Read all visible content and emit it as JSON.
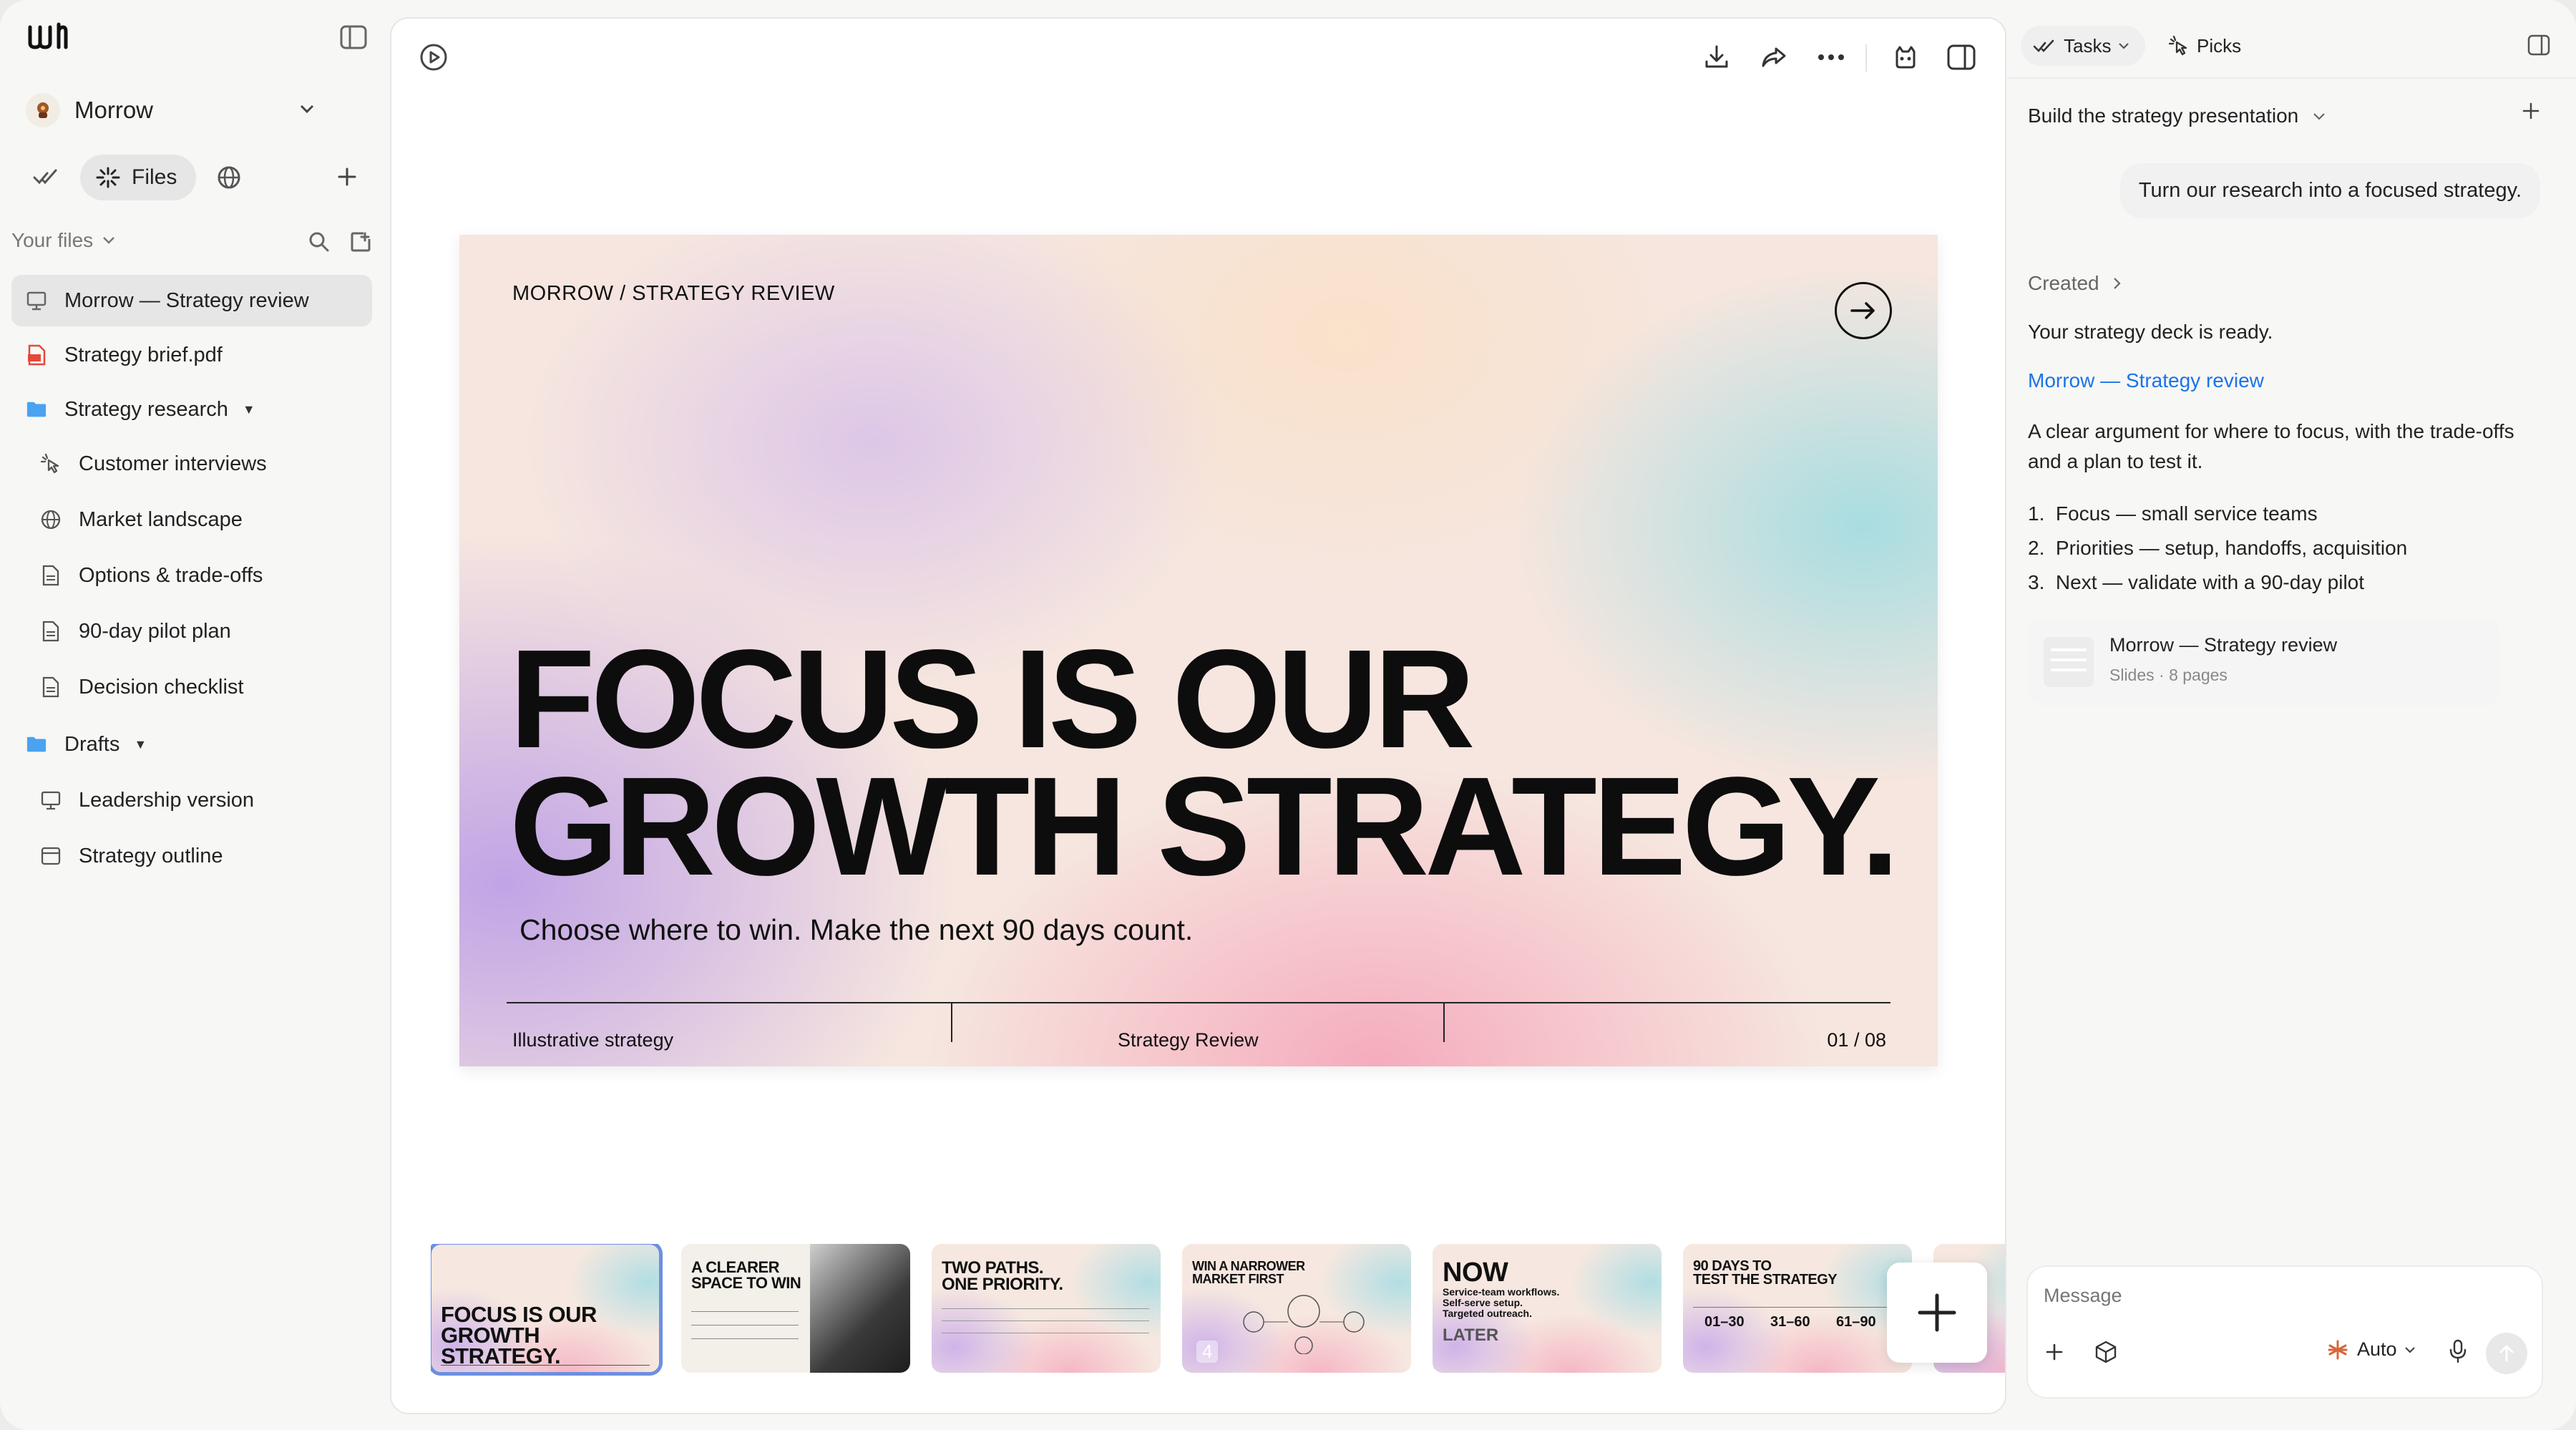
{
  "sidebar": {
    "workspace_name": "Morrow",
    "tabs": {
      "files_label": "Files"
    },
    "section_label": "Your files",
    "items": [
      {
        "label": "Morrow — Strategy review",
        "icon": "slides-icon"
      },
      {
        "label": "Strategy brief.pdf",
        "icon": "pdf-icon"
      },
      {
        "label": "Strategy research",
        "icon": "folder-icon"
      },
      {
        "label": "Customer interviews",
        "icon": "pointer-icon"
      },
      {
        "label": "Market landscape",
        "icon": "globe-icon"
      },
      {
        "label": "Options & trade-offs",
        "icon": "doc-icon"
      },
      {
        "label": "90-day pilot plan",
        "icon": "doc-icon"
      },
      {
        "label": "Decision checklist",
        "icon": "doc-icon"
      },
      {
        "label": "Drafts",
        "icon": "folder-icon"
      },
      {
        "label": "Leadership version",
        "icon": "slides-icon"
      },
      {
        "label": "Strategy outline",
        "icon": "browser-icon"
      }
    ]
  },
  "slide": {
    "kicker": "MORROW / STRATEGY REVIEW",
    "headline": "FOCUS IS OUR\nGROWTH STRATEGY.",
    "subtitle": "Choose where to win. Make the next 90 days count.",
    "footer_left": "Illustrative strategy",
    "footer_center": "Strategy Review",
    "footer_right": "01 / 08"
  },
  "thumbnails": [
    {
      "title": "FOCUS IS OUR\nGROWTH STRATEGY.",
      "selected": true
    },
    {
      "title": "A CLEARER\nSPACE TO WIN"
    },
    {
      "title": "TWO PATHS.\nONE PRIORITY."
    },
    {
      "title": "WIN A NARROWER\nMARKET FIRST",
      "number": "4"
    },
    {
      "title": "NOW",
      "sub": "Service-team workflows.\nSelf-serve setup.\nTargeted outreach.",
      "later": "LATER"
    },
    {
      "title": "90 DAYS TO\nTEST THE STRATEGY",
      "cols": [
        "01–30",
        "31–60",
        "61–90"
      ]
    }
  ],
  "panel": {
    "tasks_label": "Tasks",
    "picks_label": "Picks",
    "task_title": "Build the strategy presentation",
    "user_message": "Turn our research into a focused strategy.",
    "created_label": "Created",
    "ready_text": "Your strategy deck is ready.",
    "deck_link": "Morrow — Strategy review",
    "summary": "A clear argument for where to focus, with the trade-offs and a plan to test it.",
    "points": [
      "Focus — small service teams",
      "Priorities — setup, handoffs, acquisition",
      "Next — validate with a 90-day pilot"
    ],
    "card_title": "Morrow — Strategy review",
    "card_meta": "Slides · 8 pages",
    "composer_placeholder": "Message",
    "model_label": "Auto"
  },
  "colors": {
    "link": "#1a73e8",
    "selected_outline": "#6d8fe0",
    "folder": "#4aa3f0",
    "pdf": "#e5483b"
  }
}
